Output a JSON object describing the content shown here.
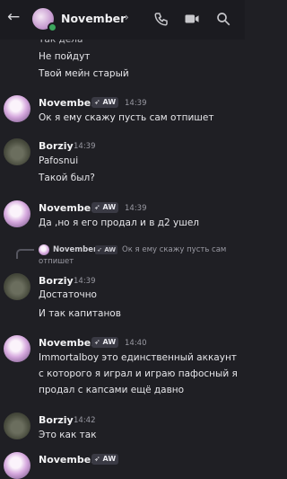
{
  "header": {
    "title": "November",
    "chevron": "›",
    "back_icon": "arrow-left",
    "call_icon": "phone-icon",
    "video_icon": "video-icon",
    "search_icon": "search-icon"
  },
  "messages": [
    {
      "lines": [
        "Так дела",
        "Не пойдут",
        "Твой мейн старый"
      ]
    },
    {
      "author": "November",
      "tag": "AW",
      "time": "14:39",
      "lines": [
        "Ок я ему скажу пусть сам отпишет"
      ]
    },
    {
      "author": "Borziy",
      "time": "14:39",
      "lines": [
        "Pafosnui",
        "Такой был?"
      ]
    },
    {
      "author": "November",
      "tag": "AW",
      "time": "14:39",
      "lines": [
        "Да ,но я его продал и в д2 ушел"
      ]
    },
    {
      "reply": {
        "author": "November",
        "tag": "AW",
        "text_1": "Ок я ему скажу пусть сам",
        "text_2": "отпишет"
      },
      "author": "Borziy",
      "time": "14:39",
      "lines": [
        "Достаточно",
        "И так капитанов"
      ]
    },
    {
      "author": "November",
      "tag": "AW",
      "time": "14:40",
      "lines": [
        "Immortalboy это единственный аккаунт",
        "с которого я играл и играю пафосный я",
        "продал с капсами ещё давно"
      ]
    },
    {
      "author": "Borziy",
      "time": "14:42",
      "lines": [
        "Это как так"
      ]
    },
    {
      "author": "November",
      "tag": "AW"
    }
  ]
}
